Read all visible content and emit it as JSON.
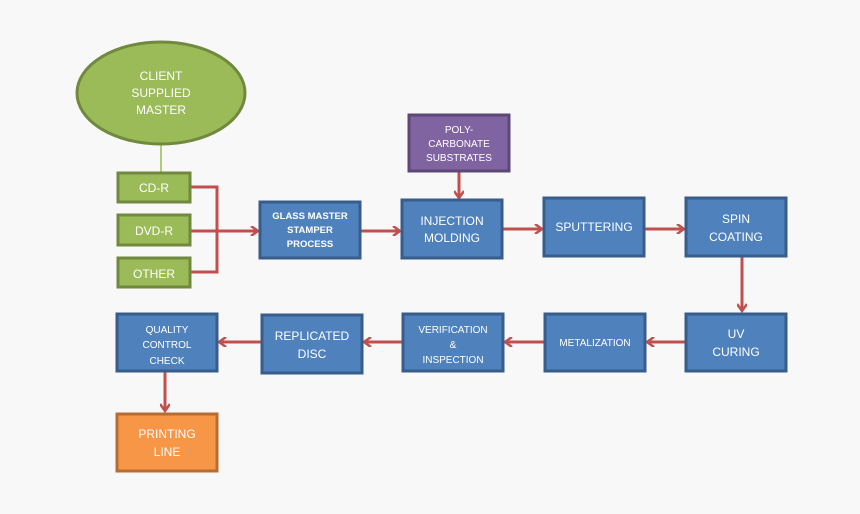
{
  "colors": {
    "process": "#4f81bd",
    "process_border": "#385d8a",
    "input": "#9bbb59",
    "input_border": "#71893f",
    "substrate": "#8064a2",
    "substrate_border": "#5c4776",
    "output": "#f79646",
    "output_border": "#b66d31",
    "arrow": "#c0504d",
    "background": "#f8f8f8"
  },
  "nodes": {
    "client": [
      "CLIENT",
      "SUPPLIED",
      "MASTER"
    ],
    "cdr": "CD-R",
    "dvdr": "DVD-R",
    "other": "OTHER",
    "glass": [
      "GLASS MASTER",
      "STAMPER",
      "PROCESS"
    ],
    "poly": [
      "POLY-",
      "CARBONATE",
      "SUBSTRATES"
    ],
    "injection": [
      "INJECTION",
      "MOLDING"
    ],
    "sputtering": "SPUTTERING",
    "spin": [
      "SPIN",
      "COATING"
    ],
    "uv": [
      "UV",
      "CURING"
    ],
    "metalization": "METALIZATION",
    "verification": [
      "VERIFICATION",
      "&",
      "INSPECTION"
    ],
    "replicated": [
      "REPLICATED",
      "DISC"
    ],
    "quality": [
      "QUALITY",
      "CONTROL",
      "CHECK"
    ],
    "printing": [
      "PRINTING",
      "LINE"
    ]
  }
}
